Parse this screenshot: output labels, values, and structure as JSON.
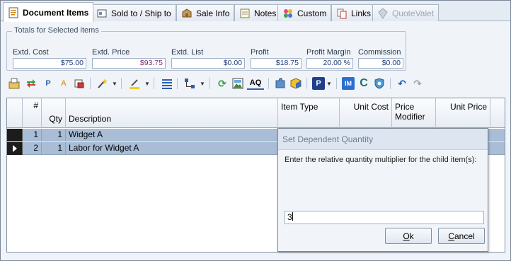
{
  "tabs": [
    {
      "label": "Document Items",
      "icon": "document-items-icon",
      "active": true
    },
    {
      "label": "Sold to / Ship to",
      "icon": "sold-to-icon"
    },
    {
      "label": "Sale Info",
      "icon": "sale-info-icon"
    },
    {
      "label": "Notes",
      "icon": "notes-icon"
    },
    {
      "label": "Custom",
      "icon": "custom-icon"
    },
    {
      "label": "Links",
      "icon": "links-icon"
    },
    {
      "label": "QuoteValet",
      "icon": "quotevalet-icon",
      "disabled": true
    }
  ],
  "totals": {
    "legend": "Totals for Selected items",
    "extd_cost": {
      "label": "Extd. Cost",
      "value": "$75.00"
    },
    "extd_price": {
      "label": "Extd. Price",
      "value": "$93.75"
    },
    "extd_list": {
      "label": "Extd. List",
      "value": "$0.00"
    },
    "profit": {
      "label": "Profit",
      "value": "$18.75"
    },
    "profit_margin": {
      "label": "Profit Margin",
      "value": "20.00 %"
    },
    "commission": {
      "label": "Commission",
      "value": "$0.00"
    }
  },
  "toolbar": {
    "p_glyph": "P",
    "a_glyph": "A",
    "aq_glyph": "AQ",
    "im_glyph": "IM",
    "c_glyph": "C",
    "pdf_glyph": "P",
    "undo_glyph": "↶",
    "redo_glyph": "↷",
    "refresh_glyph": "⟳",
    "drop_glyph": "▼"
  },
  "grid": {
    "columns": {
      "num": "#",
      "qty": "Qty",
      "description": "Description",
      "item_type": "Item Type",
      "unit_cost": "Unit Cost",
      "price_modifier": "Price Modifier",
      "unit_price": "Unit Price"
    },
    "rows": [
      {
        "num": "1",
        "qty": "1",
        "description": "Widget A"
      },
      {
        "num": "2",
        "qty": "1",
        "description": "Labor for Widget A"
      }
    ]
  },
  "dialog": {
    "title": "Set Dependent Quantity",
    "prompt": "Enter the relative quantity multiplier for the child item(s):",
    "input_value": "3",
    "ok_label": "k",
    "ok_mnemonic": "O",
    "cancel_label": "ancel",
    "cancel_mnemonic": "C"
  },
  "colors": {
    "selected_row": "#a9bdd6",
    "price_text": "#7a2a6e",
    "value_text": "#1f3a78"
  }
}
